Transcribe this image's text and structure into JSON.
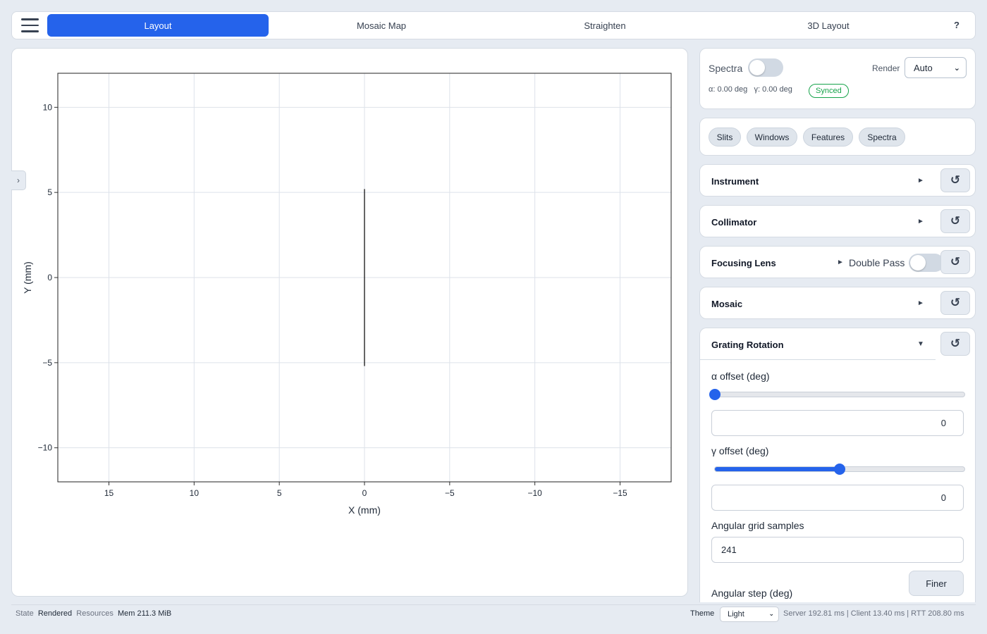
{
  "nav": {
    "tabs": [
      {
        "label": "Layout",
        "active": true
      },
      {
        "label": "Mosaic Map",
        "active": false
      },
      {
        "label": "Straighten",
        "active": false
      },
      {
        "label": "3D Layout",
        "active": false
      }
    ],
    "help": "?",
    "menu_icon": "hamburger-icon"
  },
  "plot": {
    "collapse_glyph": "›",
    "chart_data": {
      "type": "line",
      "xlabel": "X (mm)",
      "ylabel": "Y (mm)",
      "xlim": [
        18,
        -18
      ],
      "ylim": [
        -12,
        12
      ],
      "x_reversed": true,
      "xticks": [
        15,
        10,
        5,
        0,
        -5,
        -10,
        -15
      ],
      "xtick_labels": [
        "15",
        "10",
        "5",
        "0",
        "−5",
        "−10",
        "−15"
      ],
      "yticks": [
        10,
        5,
        0,
        -5,
        -10
      ],
      "ytick_labels": [
        "10",
        "5",
        "0",
        "−5",
        "−10"
      ],
      "grid": true,
      "series": [
        {
          "x": [
            0,
            0
          ],
          "y": [
            5.2,
            -5.2
          ],
          "color": "#000000"
        }
      ]
    }
  },
  "spectra": {
    "label": "Spectra",
    "toggle_on": false,
    "render_label": "Render",
    "render_value": "Auto",
    "alpha_text": "α: 0.00 deg",
    "gamma_text": "γ: 0.00 deg",
    "synced": "Synced"
  },
  "chips": [
    "Slits",
    "Windows",
    "Features",
    "Spectra"
  ],
  "sections": {
    "instrument": "Instrument",
    "collimator": "Collimator",
    "focusing": "Focusing Lens",
    "double_pass": "Double Pass",
    "mosaic": "Mosaic",
    "grating": "Grating Rotation",
    "collapsed_arrow": "►",
    "expanded_arrow": "▼",
    "reset_glyph": "↺"
  },
  "grating": {
    "alpha_label": "α offset (deg)",
    "alpha_slider_fraction": 0.0,
    "alpha_value": "0",
    "gamma_label": "γ offset (deg)",
    "gamma_slider_fraction": 0.5,
    "gamma_value": "0",
    "samples_label": "Angular grid samples",
    "samples_value": "241",
    "finer_label": "Finer",
    "step_label": "Angular step (deg)"
  },
  "status": {
    "state_label": "State",
    "state_value": "Rendered",
    "resources_label": "Resources",
    "resources_value": "Mem 211.3 MiB",
    "theme_label": "Theme",
    "theme_value": "Light",
    "timing": "Server 192.81 ms | Client 13.40 ms | RTT 208.80 ms"
  },
  "colors": {
    "accent": "#2563eb",
    "synced": "#16a34a"
  }
}
